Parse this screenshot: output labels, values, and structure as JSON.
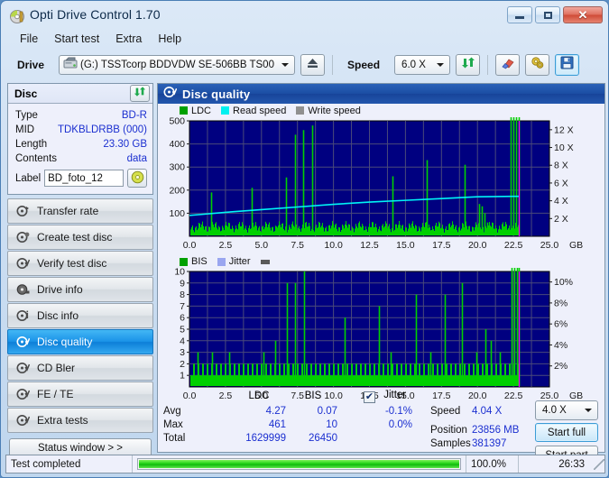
{
  "window": {
    "title": "Opti Drive Control 1.70",
    "icon": "disc-icon",
    "buttons": {
      "minimize": "minimize-icon",
      "maximize": "maximize-icon",
      "close": "close-icon"
    }
  },
  "menu": {
    "items": [
      "File",
      "Start test",
      "Extra",
      "Help"
    ]
  },
  "toolbar": {
    "drive_label": "Drive",
    "drive_value": "(G:)  TSSTcorp BDDVDW SE-506BB TS00",
    "eject_icon": "eject-icon",
    "speed_label": "Speed",
    "speed_value": "6.0 X",
    "refresh_icon": "refresh-icon",
    "erase_icon": "eraser-icon",
    "settings_icon": "gear-icon",
    "save_icon": "save-icon"
  },
  "disc": {
    "header": "Disc",
    "refresh_icon": "refresh-icon",
    "type_label": "Type",
    "type_value": "BD-R",
    "mid_label": "MID",
    "mid_value": "TDKBLDRBB (000)",
    "length_label": "Length",
    "length_value": "23.30 GB",
    "contents_label": "Contents",
    "contents_value": "data",
    "label_label": "Label",
    "label_value": "BD_foto_12",
    "disc_icon": "cd-disc-icon"
  },
  "nav": {
    "items": [
      {
        "label": "Transfer rate",
        "icon": "disc-speed-icon",
        "active": false
      },
      {
        "label": "Create test disc",
        "icon": "disc-write-icon",
        "active": false
      },
      {
        "label": "Verify test disc",
        "icon": "disc-verify-icon",
        "active": false
      },
      {
        "label": "Drive info",
        "icon": "drive-icon",
        "active": false
      },
      {
        "label": "Disc info",
        "icon": "disc-info-icon",
        "active": false
      },
      {
        "label": "Disc quality",
        "icon": "disc-quality-icon",
        "active": true
      },
      {
        "label": "CD Bler",
        "icon": "disc-bler-icon",
        "active": false
      },
      {
        "label": "FE / TE",
        "icon": "disc-fete-icon",
        "active": false
      },
      {
        "label": "Extra tests",
        "icon": "disc-extra-icon",
        "active": false
      }
    ],
    "status_window_button": "Status window > >"
  },
  "panel": {
    "header_title": "Disc quality",
    "header_icon": "disc-quality-icon"
  },
  "chart_data": [
    {
      "type": "line",
      "name": "ldc-chart",
      "title": "",
      "legend": [
        {
          "label": "LDC",
          "color": "#00a000"
        },
        {
          "label": "Read speed",
          "color": "#00f0f0"
        },
        {
          "label": "Write speed",
          "color": "#909090"
        }
      ],
      "legend_position": "top-left",
      "grid": true,
      "xlabel": "GB",
      "xticks": [
        "0.0",
        "2.5",
        "5.0",
        "7.5",
        "10.0",
        "12.5",
        "15.0",
        "17.5",
        "20.0",
        "22.5",
        "25.0"
      ],
      "xlim": [
        0,
        25
      ],
      "ylabel_left": "",
      "yticks_left": [
        "500",
        "400",
        "300",
        "200",
        "100"
      ],
      "ylim_left": [
        0,
        500
      ],
      "ylabel_right": "",
      "yticks_right": [
        "12 X",
        "10 X",
        "8 X",
        "6 X",
        "4 X",
        "2 X"
      ],
      "ylim_right": [
        0,
        13
      ],
      "end_marker_gb": 22.9,
      "series": [
        {
          "name": "LDC",
          "color": "#00d000",
          "x": [
            0.1,
            0.3,
            0.5,
            0.7,
            0.9,
            1.1,
            1.3,
            1.5,
            1.7,
            1.9,
            2.1,
            2.3,
            2.5,
            2.7,
            2.9,
            3.1,
            3.3,
            3.5,
            3.7,
            3.9,
            4.1,
            4.3,
            4.5,
            4.7,
            4.9,
            5.1,
            5.3,
            5.5,
            5.7,
            5.9,
            6.1,
            6.3,
            6.5,
            6.7,
            6.9,
            7.1,
            7.3,
            7.5,
            7.7,
            7.9,
            8.1,
            8.3,
            8.5,
            8.7,
            8.9,
            9.1,
            9.3,
            9.5,
            9.7,
            9.9,
            10.1,
            10.3,
            10.5,
            10.7,
            10.9,
            11.1,
            11.3,
            11.5,
            11.7,
            11.9,
            12.1,
            12.3,
            12.5,
            12.7,
            12.9,
            13.1,
            13.3,
            13.5,
            13.7,
            13.9,
            14.1,
            14.3,
            14.5,
            14.7,
            14.9,
            15.1,
            15.3,
            15.5,
            15.7,
            15.9,
            16.1,
            16.3,
            16.5,
            16.7,
            16.9,
            17.1,
            17.3,
            17.5,
            17.7,
            17.9,
            18.1,
            18.3,
            18.5,
            18.7,
            18.9,
            19.1,
            19.3,
            19.5,
            19.7,
            19.9,
            20.1,
            20.3,
            20.5,
            20.7,
            20.9,
            21.1,
            21.3,
            21.5,
            21.7,
            21.9,
            22.1,
            22.3,
            22.5,
            22.7,
            22.9
          ],
          "values": [
            30,
            18,
            14,
            20,
            16,
            12,
            22,
            190,
            30,
            18,
            22,
            14,
            20,
            16,
            26,
            18,
            14,
            22,
            40,
            14,
            18,
            210,
            24,
            16,
            20,
            14,
            18,
            26,
            16,
            20,
            38,
            16,
            14,
            255,
            22,
            18,
            440,
            36,
            20,
            460,
            28,
            18,
            480,
            24,
            16,
            20,
            18,
            14,
            26,
            20,
            16,
            22,
            18,
            24,
            16,
            20,
            18,
            14,
            22,
            18,
            26,
            16,
            20,
            14,
            18,
            22,
            16,
            20,
            18,
            16,
            260,
            30,
            18,
            22,
            16,
            20,
            14,
            18,
            22,
            16,
            20,
            18,
            330,
            26,
            18,
            22,
            16,
            20,
            14,
            18,
            22,
            26,
            16,
            20,
            18,
            310,
            24,
            16,
            20,
            22,
            140,
            130,
            100,
            60,
            40,
            20,
            18,
            22,
            16,
            14,
            10
          ]
        },
        {
          "name": "Read speed",
          "color": "#00f5f5",
          "x": [
            0.0,
            2.5,
            5.0,
            7.5,
            10.0,
            12.5,
            15.0,
            17.5,
            20.0,
            22.5,
            22.9
          ],
          "values": [
            2.35,
            2.7,
            3.0,
            3.3,
            3.6,
            3.85,
            4.05,
            4.25,
            4.45,
            4.5,
            4.5
          ]
        }
      ]
    },
    {
      "type": "line",
      "name": "bis-chart",
      "title": "",
      "legend": [
        {
          "label": "BIS",
          "color": "#00a000"
        },
        {
          "label": "Jitter",
          "color": "#9aa6f0"
        }
      ],
      "legend_position": "top-left",
      "grid": true,
      "xlabel": "GB",
      "xticks": [
        "0.0",
        "2.5",
        "5.0",
        "7.5",
        "10.0",
        "12.5",
        "15.0",
        "17.5",
        "20.0",
        "22.5",
        "25.0"
      ],
      "xlim": [
        0,
        25
      ],
      "yticks_left": [
        "10",
        "9",
        "8",
        "7",
        "6",
        "5",
        "4",
        "3",
        "2",
        "1"
      ],
      "ylim_left": [
        0,
        10
      ],
      "yticks_right": [
        "10%",
        "8%",
        "6%",
        "4%",
        "2%"
      ],
      "ylim_right": [
        0,
        11
      ],
      "end_marker_gb": 22.9,
      "series": [
        {
          "name": "BIS",
          "color": "#00d000",
          "x": [
            0.15,
            0.35,
            0.55,
            0.75,
            0.95,
            1.15,
            1.35,
            1.55,
            1.75,
            1.95,
            2.15,
            2.35,
            2.55,
            2.75,
            2.95,
            3.15,
            3.35,
            3.55,
            3.75,
            3.95,
            4.15,
            4.35,
            4.55,
            4.75,
            4.95,
            5.15,
            5.35,
            5.55,
            5.75,
            5.95,
            6.15,
            6.35,
            6.55,
            6.75,
            6.95,
            7.15,
            7.35,
            7.55,
            7.75,
            7.95,
            8.15,
            8.35,
            8.55,
            8.75,
            8.95,
            9.15,
            9.35,
            9.55,
            9.75,
            9.95,
            10.15,
            10.35,
            10.55,
            10.75,
            10.95,
            11.15,
            11.35,
            11.55,
            11.75,
            11.95,
            12.15,
            12.35,
            12.55,
            12.75,
            12.95,
            13.15,
            13.35,
            13.55,
            13.75,
            13.95,
            14.15,
            14.35,
            14.55,
            14.75,
            14.95,
            15.15,
            15.35,
            15.55,
            15.75,
            15.95,
            16.15,
            16.35,
            16.55,
            16.75,
            16.95,
            17.15,
            17.35,
            17.55,
            17.75,
            17.95,
            18.15,
            18.35,
            18.55,
            18.75,
            18.95,
            19.15,
            19.35,
            19.55,
            19.75,
            19.95,
            20.15,
            20.35,
            20.55,
            20.75,
            20.95,
            21.15,
            21.35,
            21.55,
            21.75,
            21.95,
            22.15,
            22.35,
            22.55,
            22.75,
            22.9
          ],
          "values": [
            2,
            1,
            3,
            1,
            2,
            1,
            2,
            3,
            1,
            2,
            1,
            2,
            1,
            3,
            2,
            1,
            2,
            1,
            2,
            1,
            2,
            1,
            2,
            1,
            2,
            3,
            1,
            2,
            1,
            4,
            2,
            1,
            2,
            9,
            2,
            1,
            9,
            2,
            1,
            10,
            2,
            1,
            2,
            1,
            2,
            1,
            2,
            1,
            2,
            1,
            2,
            1,
            2,
            6,
            1,
            2,
            1,
            2,
            1,
            2,
            1,
            2,
            1,
            2,
            1,
            7,
            2,
            1,
            2,
            3,
            1,
            2,
            1,
            2,
            1,
            2,
            1,
            2,
            8,
            1,
            2,
            1,
            2,
            3,
            1,
            2,
            1,
            2,
            8,
            2,
            1,
            2,
            1,
            2,
            9,
            1,
            2,
            1,
            2,
            3,
            2,
            1,
            5,
            2,
            4,
            1,
            2,
            3,
            2,
            1,
            1
          ]
        }
      ]
    }
  ],
  "stats": {
    "columns": [
      "LDC",
      "BIS"
    ],
    "jitter_label": "Jitter",
    "jitter_checked": true,
    "rows": [
      {
        "label": "Avg",
        "ldc": "4.27",
        "bis": "0.07",
        "jitter": "-0.1%"
      },
      {
        "label": "Max",
        "ldc": "461",
        "bis": "10",
        "jitter": "0.0%"
      },
      {
        "label": "Total",
        "ldc": "1629999",
        "bis": "26450",
        "jitter": ""
      }
    ],
    "speed_label": "Speed",
    "speed_value": "4.04 X",
    "position_label": "Position",
    "position_value": "23856 MB",
    "samples_label": "Samples",
    "samples_value": "381397",
    "speed_select": "4.0 X",
    "start_full_button": "Start full",
    "start_part_button": "Start part"
  },
  "statusbar": {
    "text": "Test completed",
    "progress_percent": 100,
    "percent_label": "100.0%",
    "time": "26:33"
  },
  "colors": {
    "accent": "#1b4da3",
    "plot_bg": "#000080",
    "series_green": "#00d000",
    "series_cyan": "#00f5f5",
    "end_marker": "#ff00ff",
    "value_blue": "#1b2fd0"
  }
}
